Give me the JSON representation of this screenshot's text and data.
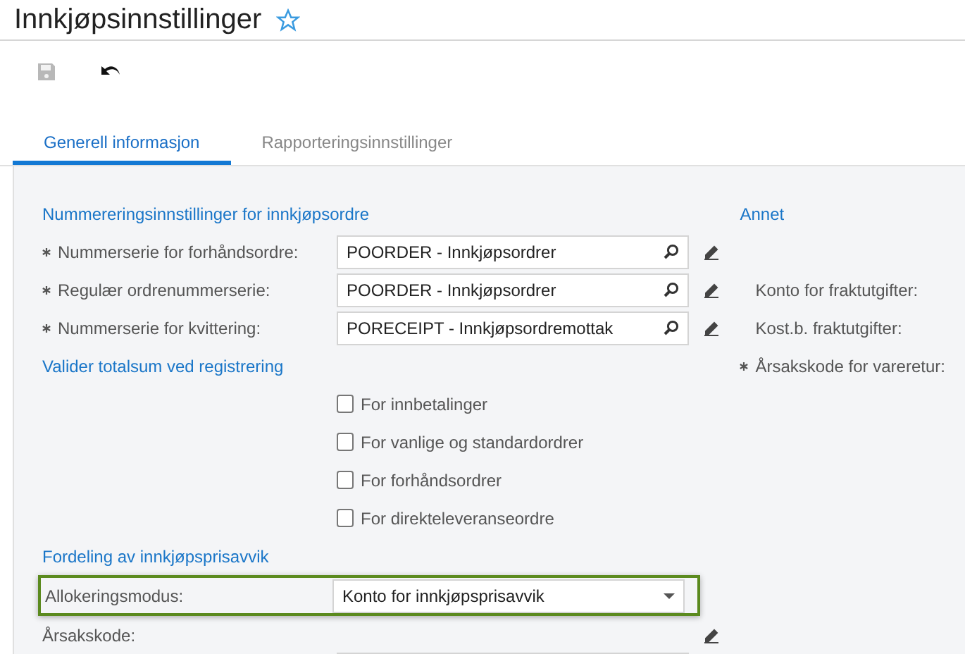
{
  "title": "Innkjøpsinnstillinger",
  "favorite": false,
  "tabs": [
    {
      "label": "Generell informasjon",
      "selected": true
    },
    {
      "label": "Rapporteringsinnstillinger",
      "selected": false
    }
  ],
  "numbering": {
    "heading": "Nummereringsinnstillinger for innkjøpsordre",
    "rows": [
      {
        "label": "Nummerserie for forhåndsordre:",
        "required": true,
        "value": "POORDER - Innkjøpsordrer"
      },
      {
        "label": "Regulær ordrenummerserie:",
        "required": true,
        "value": "POORDER - Innkjøpsordrer"
      },
      {
        "label": "Nummerserie for kvittering:",
        "required": true,
        "value": "PORECEIPT - Innkjøpsordremottak"
      }
    ]
  },
  "validation": {
    "heading": "Valider totalsum ved registrering",
    "options": [
      {
        "label": "For innbetalinger",
        "checked": false
      },
      {
        "label": "For vanlige og standardordrer",
        "checked": false
      },
      {
        "label": "For forhåndsordrer",
        "checked": false
      },
      {
        "label": "For direkteleveranseordre",
        "checked": false
      }
    ]
  },
  "distribution": {
    "heading": "Fordeling av innkjøpsprisavvik",
    "allocation": {
      "label": "Allokeringsmodus:",
      "value": "Konto for innkjøpsprisavvik",
      "highlighted": true
    },
    "reason": {
      "label": "Årsakskode:"
    }
  },
  "other": {
    "heading": "Annet",
    "rows": [
      {
        "label": "Konto for fraktutgifter:",
        "required": false
      },
      {
        "label": "Kost.b. fraktutgifter:",
        "required": false
      },
      {
        "label": "Årsakskode for vareretur:",
        "required": true
      }
    ]
  }
}
